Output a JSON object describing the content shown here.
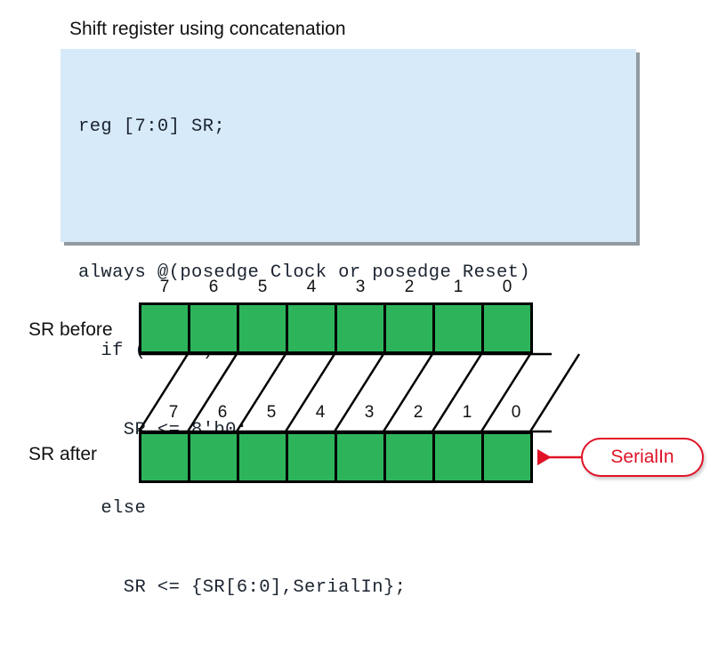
{
  "slide": {
    "title": "Shift register using concatenation"
  },
  "code": {
    "language": "verilog",
    "lines": [
      "reg [7:0] SR;",
      "",
      "always @(posedge Clock or posedge Reset)",
      "  if (Reset)",
      "    SR <= 8'b0;",
      "  else",
      "    SR <= {SR[6:0],SerialIn};"
    ]
  },
  "diagram": {
    "before_row_label": "SR before",
    "after_row_label": "SR after",
    "bit_indices_before": [
      "7",
      "6",
      "5",
      "4",
      "3",
      "2",
      "1",
      "0"
    ],
    "bit_indices_after": [
      "7",
      "6",
      "5",
      "4",
      "3",
      "2",
      "1",
      "0"
    ],
    "cell_count": 8,
    "cell_fill_color": "#2db45b",
    "cell_border_color": "#000000",
    "callout": {
      "label": "SerialIn",
      "color": "#e01226"
    }
  },
  "colors": {
    "code_background": "#d7eaf9",
    "code_shadow": "#919aa0",
    "code_text": "#1b2430",
    "register_green": "#2db45b",
    "accent_red": "#e01226",
    "page_background": "#ffffff"
  }
}
